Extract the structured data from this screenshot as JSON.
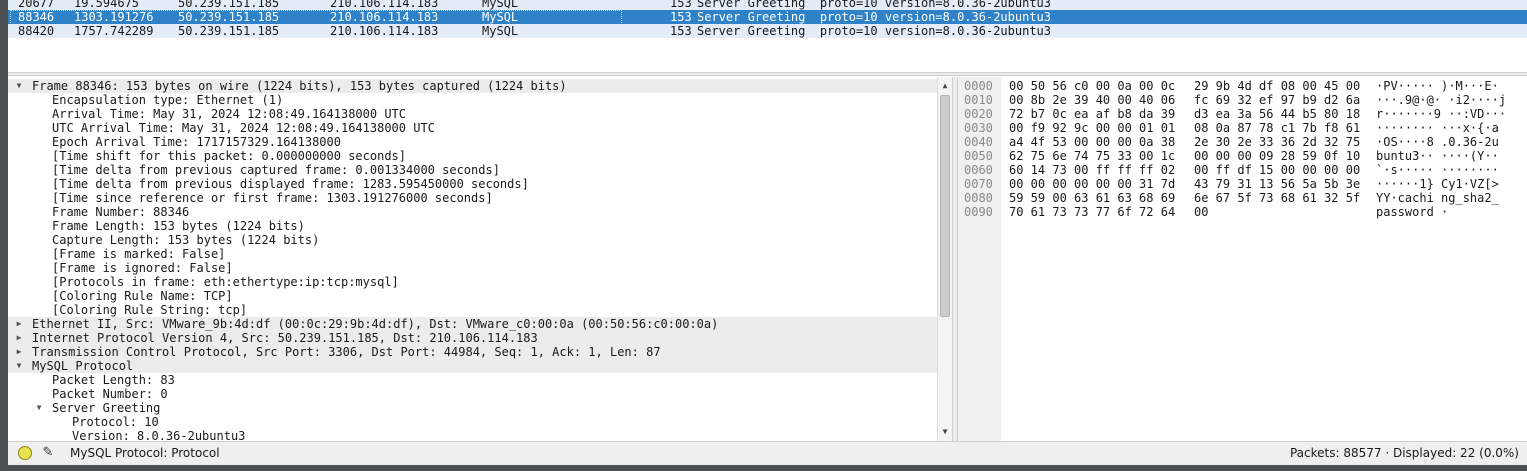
{
  "packet_list": {
    "rows": [
      {
        "no": "20677",
        "time": "19.594675",
        "src": "50.239.151.185",
        "dst": "210.106.114.183",
        "proto": "MySQL",
        "len": "153",
        "info": "Server Greeting  proto=10 version=8.0.36-2ubuntu3"
      },
      {
        "no": "88346",
        "time": "1303.191276",
        "src": "50.239.151.185",
        "dst": "210.106.114.183",
        "proto": "MySQL",
        "len": "153",
        "info": "Server Greeting  proto=10 version=8.0.36-2ubuntu3"
      },
      {
        "no": "88420",
        "time": "1757.742289",
        "src": "50.239.151.185",
        "dst": "210.106.114.183",
        "proto": "MySQL",
        "len": "153",
        "info": "Server Greeting  proto=10 version=8.0.36-2ubuntu3"
      }
    ]
  },
  "details": {
    "rows": [
      {
        "text": "Frame 88346: 153 bytes on wire (1224 bits), 153 bytes captured (1224 bits)",
        "arrow": "expanded"
      },
      {
        "text": "Encapsulation type: Ethernet (1)",
        "arrow": ""
      },
      {
        "text": "Arrival Time: May 31, 2024 12:08:49.164138000 UTC",
        "arrow": ""
      },
      {
        "text": "UTC Arrival Time: May 31, 2024 12:08:49.164138000 UTC",
        "arrow": ""
      },
      {
        "text": "Epoch Arrival Time: 1717157329.164138000",
        "arrow": ""
      },
      {
        "text": "[Time shift for this packet: 0.000000000 seconds]",
        "arrow": ""
      },
      {
        "text": "[Time delta from previous captured frame: 0.001334000 seconds]",
        "arrow": ""
      },
      {
        "text": "[Time delta from previous displayed frame: 1283.595450000 seconds]",
        "arrow": ""
      },
      {
        "text": "[Time since reference or first frame: 1303.191276000 seconds]",
        "arrow": ""
      },
      {
        "text": "Frame Number: 88346",
        "arrow": ""
      },
      {
        "text": "Frame Length: 153 bytes (1224 bits)",
        "arrow": ""
      },
      {
        "text": "Capture Length: 153 bytes (1224 bits)",
        "arrow": ""
      },
      {
        "text": "[Frame is marked: False]",
        "arrow": ""
      },
      {
        "text": "[Frame is ignored: False]",
        "arrow": ""
      },
      {
        "text": "[Protocols in frame: eth:ethertype:ip:tcp:mysql]",
        "arrow": ""
      },
      {
        "text": "[Coloring Rule Name: TCP]",
        "arrow": ""
      },
      {
        "text": "[Coloring Rule String: tcp]",
        "arrow": ""
      },
      {
        "text": "Ethernet II, Src: VMware_9b:4d:df (00:0c:29:9b:4d:df), Dst: VMware_c0:00:0a (00:50:56:c0:00:0a)",
        "arrow": "collapsed"
      },
      {
        "text": "Internet Protocol Version 4, Src: 50.239.151.185, Dst: 210.106.114.183",
        "arrow": "collapsed"
      },
      {
        "text": "Transmission Control Protocol, Src Port: 3306, Dst Port: 44984, Seq: 1, Ack: 1, Len: 87",
        "arrow": "collapsed"
      },
      {
        "text": "MySQL Protocol",
        "arrow": "expanded"
      },
      {
        "text": "Packet Length: 83",
        "arrow": ""
      },
      {
        "text": "Packet Number: 0",
        "arrow": ""
      },
      {
        "text": "Server Greeting",
        "arrow": "expanded"
      },
      {
        "text": "Protocol: 10",
        "arrow": ""
      },
      {
        "text": "Version: 8.0.36-2ubuntu3",
        "arrow": ""
      }
    ]
  },
  "bytes": {
    "rows": [
      {
        "offset": "0000",
        "hex1": "00 50 56 c0 00 0a 00 0c",
        "hex2": "29 9b 4d df 08 00 45 00",
        "ascii": "·PV····· )·M···E·"
      },
      {
        "offset": "0010",
        "hex1": "00 8b 2e 39 40 00 40 06",
        "hex2": "fc 69 32 ef 97 b9 d2 6a",
        "ascii": "···.9@·@· ·i2····j"
      },
      {
        "offset": "0020",
        "hex1": "72 b7 0c ea af b8 da 39",
        "hex2": "d3 ea 3a 56 44 b5 80 18",
        "ascii": "r·······9 ··:VD···"
      },
      {
        "offset": "0030",
        "hex1": "00 f9 92 9c 00 00 01 01",
        "hex2": "08 0a 87 78 c1 7b f8 61",
        "ascii": "········ ···x·{·a"
      },
      {
        "offset": "0040",
        "hex1": "a4 4f 53 00 00 00 0a 38",
        "hex2": "2e 30 2e 33 36 2d 32 75",
        "ascii": "·OS····8 .0.36-2u"
      },
      {
        "offset": "0050",
        "hex1": "62 75 6e 74 75 33 00 1c",
        "hex2": "00 00 00 09 28 59 0f 10",
        "ascii": "buntu3·· ····(Y··"
      },
      {
        "offset": "0060",
        "hex1": "60 14 73 00 ff ff ff 02",
        "hex2": "00 ff df 15 00 00 00 00",
        "ascii": "`·s····· ········"
      },
      {
        "offset": "0070",
        "hex1": "00 00 00 00 00 00 31 7d",
        "hex2": "43 79 31 13 56 5a 5b 3e",
        "ascii": "······1} Cy1·VZ[>"
      },
      {
        "offset": "0080",
        "hex1": "59 59 00 63 61 63 68 69",
        "hex2": "6e 67 5f 73 68 61 32 5f",
        "ascii": "YY·cachi ng_sha2_"
      },
      {
        "offset": "0090",
        "hex1": "70 61 73 73 77 6f 72 64",
        "hex2": "00",
        "ascii": "password ·"
      }
    ]
  },
  "status": {
    "field_label": "MySQL Protocol: Protocol",
    "counts": "Packets: 88577 · Displayed: 22 (0.0%)"
  },
  "icons": {
    "expanded_arrow": "▼",
    "collapsed_arrow": "▶",
    "scroll_up": "▲",
    "scroll_down": "▼",
    "comment": "✎"
  },
  "colors": {
    "selected_row": "#2f82c8",
    "row_bg": "#e4ecf7",
    "expert_dot": "#e8e34a"
  }
}
